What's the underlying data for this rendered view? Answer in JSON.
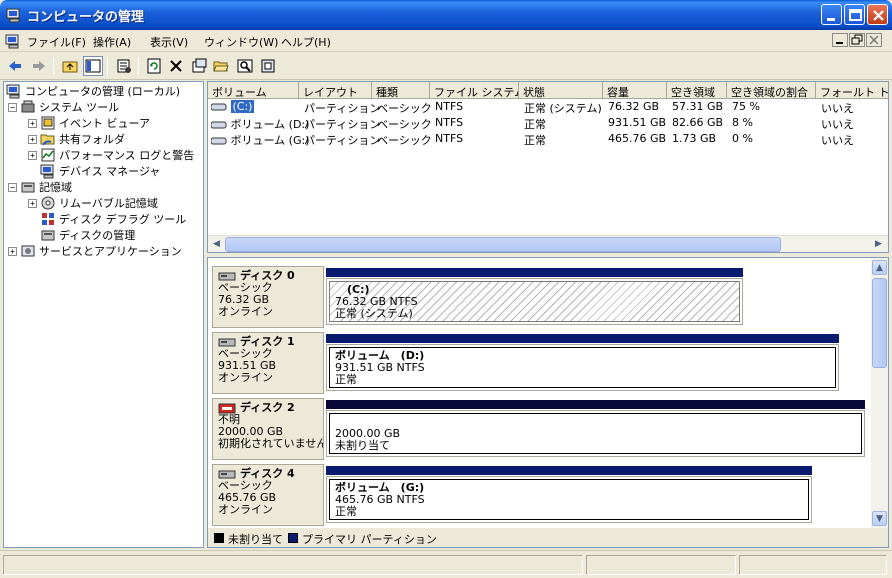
{
  "window": {
    "title": "コンピュータの管理"
  },
  "menu": {
    "items": [
      "ファイル(F)",
      "操作(A)",
      "表示(V)",
      "ウィンドウ(W)",
      "ヘルプ(H)"
    ]
  },
  "toolbar": {
    "icons": [
      "back-icon",
      "forward-icon",
      "up-folder-icon",
      "show-tree-icon",
      "properties-icon",
      "refresh-icon",
      "delete-icon",
      "properties-sheet-icon",
      "open-folder-icon",
      "search-icon",
      "help-icon"
    ]
  },
  "tree": {
    "root": "コンピュータの管理 (ローカル)",
    "system_tools": "システム ツール",
    "event_viewer": "イベント ビューア",
    "shared_folders": "共有フォルダ",
    "perf_logs": "パフォーマンス ログと警告",
    "device_manager": "デバイス マネージャ",
    "storage": "記憶域",
    "removable": "リムーバブル記憶域",
    "defrag": "ディスク デフラグ ツール",
    "disk_management": "ディスクの管理",
    "services_apps": "サービスとアプリケーション"
  },
  "volumes": {
    "headers": [
      "ボリューム",
      "レイアウト",
      "種類",
      "ファイル システム",
      "状態",
      "容量",
      "空き領域",
      "空き領域の割合",
      "フォールト トレ"
    ],
    "rows": [
      [
        "(C:)",
        "パーティション",
        "ベーシック",
        "NTFS",
        "正常 (システム)",
        "76.32 GB",
        "57.31 GB",
        "75 %",
        "いいえ"
      ],
      [
        "ボリューム (D:)",
        "パーティション",
        "ベーシック",
        "NTFS",
        "正常",
        "931.51 GB",
        "82.66 GB",
        "8 %",
        "いいえ"
      ],
      [
        "ボリューム (G:)",
        "パーティション",
        "ベーシック",
        "NTFS",
        "正常",
        "465.76 GB",
        "1.73 GB",
        "0 %",
        "いいえ"
      ]
    ]
  },
  "disks": [
    {
      "name": "ディスク 0",
      "type": "ベーシック",
      "size": "76.32 GB",
      "status": "オンライン",
      "vol_name": "(C:)",
      "vol_info": "76.32 GB NTFS",
      "vol_status": "正常 (システム)"
    },
    {
      "name": "ディスク 1",
      "type": "ベーシック",
      "size": "931.51 GB",
      "status": "オンライン",
      "vol_name": "ボリューム　(D:)",
      "vol_info": "931.51 GB NTFS",
      "vol_status": "正常"
    },
    {
      "name": "ディスク 2",
      "type": "不明",
      "size": "2000.00 GB",
      "status": "初期化されていません",
      "vol_name": "",
      "vol_info": "2000.00 GB",
      "vol_status": "未割り当て"
    },
    {
      "name": "ディスク 4",
      "type": "ベーシック",
      "size": "465.76 GB",
      "status": "オンライン",
      "vol_name": "ボリューム　(G:)",
      "vol_info": "465.76 GB NTFS",
      "vol_status": "正常"
    }
  ],
  "legend": {
    "unallocated": "未割り当て",
    "primary": "プライマリ パーティション",
    "unallocated_color": "#000000",
    "primary_color": "#0a1a6e"
  }
}
